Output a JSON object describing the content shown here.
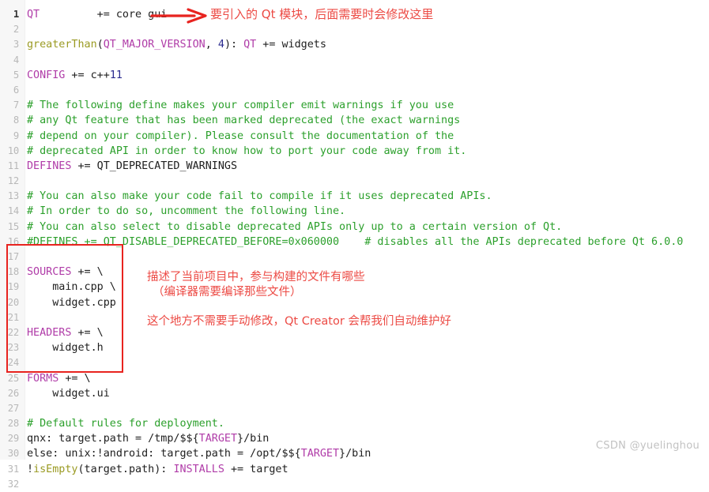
{
  "editor": {
    "language": "qmake",
    "colors": {
      "background": "#ffffff",
      "gutter": "#f7f7f7",
      "lineno": "#b8b8b8",
      "lineno_current": "#333333",
      "variable": "#b03ca8",
      "function": "#9a9a22",
      "comment": "#2ca02c",
      "number": "#2b2b8f",
      "plain": "#202020",
      "annotation_red": "#ec4a44",
      "box_red": "#e8231f"
    },
    "current_line": 1,
    "lines": [
      {
        "n": 1,
        "tokens": [
          {
            "t": "QT",
            "c": "var"
          },
          {
            "t": "         += core gui",
            "c": "plain"
          }
        ]
      },
      {
        "n": 2,
        "tokens": []
      },
      {
        "n": 3,
        "tokens": [
          {
            "t": "greaterThan",
            "c": "func"
          },
          {
            "t": "(",
            "c": "punct"
          },
          {
            "t": "QT_MAJOR_VERSION",
            "c": "var"
          },
          {
            "t": ", ",
            "c": "punct"
          },
          {
            "t": "4",
            "c": "num"
          },
          {
            "t": "): ",
            "c": "punct"
          },
          {
            "t": "QT",
            "c": "var"
          },
          {
            "t": " += widgets",
            "c": "plain"
          }
        ]
      },
      {
        "n": 4,
        "tokens": []
      },
      {
        "n": 5,
        "tokens": [
          {
            "t": "CONFIG",
            "c": "var"
          },
          {
            "t": " += c++",
            "c": "plain"
          },
          {
            "t": "11",
            "c": "num"
          }
        ]
      },
      {
        "n": 6,
        "tokens": []
      },
      {
        "n": 7,
        "tokens": [
          {
            "t": "# The following define makes your compiler emit warnings if you use",
            "c": "comment"
          }
        ]
      },
      {
        "n": 8,
        "tokens": [
          {
            "t": "# any Qt feature that has been marked deprecated (the exact warnings",
            "c": "comment"
          }
        ]
      },
      {
        "n": 9,
        "tokens": [
          {
            "t": "# depend on your compiler). Please consult the documentation of the",
            "c": "comment"
          }
        ]
      },
      {
        "n": 10,
        "tokens": [
          {
            "t": "# deprecated API in order to know how to port your code away from it.",
            "c": "comment"
          }
        ]
      },
      {
        "n": 11,
        "tokens": [
          {
            "t": "DEFINES",
            "c": "var"
          },
          {
            "t": " += QT_DEPRECATED_WARNINGS",
            "c": "plain"
          }
        ]
      },
      {
        "n": 12,
        "tokens": []
      },
      {
        "n": 13,
        "tokens": [
          {
            "t": "# You can also make your code fail to compile if it uses deprecated APIs.",
            "c": "comment"
          }
        ]
      },
      {
        "n": 14,
        "tokens": [
          {
            "t": "# In order to do so, uncomment the following line.",
            "c": "comment"
          }
        ]
      },
      {
        "n": 15,
        "tokens": [
          {
            "t": "# You can also select to disable deprecated APIs only up to a certain version of Qt.",
            "c": "comment"
          }
        ]
      },
      {
        "n": 16,
        "tokens": [
          {
            "t": "#DEFINES += QT_DISABLE_DEPRECATED_BEFORE=0x060000    # disables all the APIs deprecated before Qt 6.0.0",
            "c": "comment"
          }
        ]
      },
      {
        "n": 17,
        "tokens": []
      },
      {
        "n": 18,
        "tokens": [
          {
            "t": "SOURCES",
            "c": "var"
          },
          {
            "t": " += \\",
            "c": "plain"
          }
        ]
      },
      {
        "n": 19,
        "tokens": [
          {
            "t": "    main.cpp \\",
            "c": "plain"
          }
        ]
      },
      {
        "n": 20,
        "tokens": [
          {
            "t": "    widget.cpp",
            "c": "plain"
          }
        ]
      },
      {
        "n": 21,
        "tokens": []
      },
      {
        "n": 22,
        "tokens": [
          {
            "t": "HEADERS",
            "c": "var"
          },
          {
            "t": " += \\",
            "c": "plain"
          }
        ]
      },
      {
        "n": 23,
        "tokens": [
          {
            "t": "    widget.h",
            "c": "plain"
          }
        ]
      },
      {
        "n": 24,
        "tokens": []
      },
      {
        "n": 25,
        "tokens": [
          {
            "t": "FORMS",
            "c": "var"
          },
          {
            "t": " += \\",
            "c": "plain"
          }
        ]
      },
      {
        "n": 26,
        "tokens": [
          {
            "t": "    widget.ui",
            "c": "plain"
          }
        ]
      },
      {
        "n": 27,
        "tokens": []
      },
      {
        "n": 28,
        "tokens": [
          {
            "t": "# Default rules for deployment.",
            "c": "comment"
          }
        ]
      },
      {
        "n": 29,
        "tokens": [
          {
            "t": "qnx: target.path = /tmp/$${",
            "c": "plain"
          },
          {
            "t": "TARGET",
            "c": "var"
          },
          {
            "t": "}/bin",
            "c": "plain"
          }
        ]
      },
      {
        "n": 30,
        "tokens": [
          {
            "t": "else: unix:!android: target.path = /opt/$${",
            "c": "plain"
          },
          {
            "t": "TARGET",
            "c": "var"
          },
          {
            "t": "}/bin",
            "c": "plain"
          }
        ]
      },
      {
        "n": 31,
        "tokens": [
          {
            "t": "!",
            "c": "plain"
          },
          {
            "t": "isEmpty",
            "c": "func"
          },
          {
            "t": "(target.path): ",
            "c": "plain"
          },
          {
            "t": "INSTALLS",
            "c": "var"
          },
          {
            "t": " += target",
            "c": "plain"
          }
        ]
      },
      {
        "n": 32,
        "tokens": []
      }
    ]
  },
  "annotations": {
    "arrow_label": "arrow pointing right from line 1",
    "line1_note": "要引入的 Qt 模块，后面需要时会修改这里",
    "sources_note_1": "描述了当前项目中，参与构建的文件有哪些",
    "sources_note_2": "（编译器需要编译那些文件）",
    "sources_note_3": "这个地方不需要手动修改，Qt Creator 会帮我们自动维护好",
    "sources_box_label": "red highlight box around SOURCES/HEADERS/FORMS"
  },
  "watermark": {
    "text": "CSDN @yuelinghou"
  }
}
